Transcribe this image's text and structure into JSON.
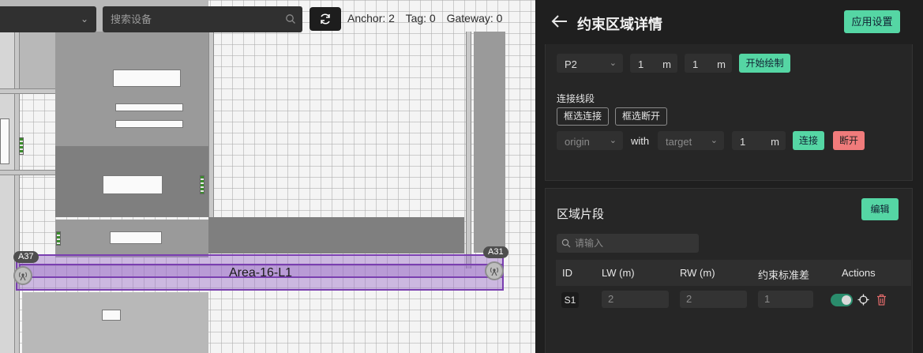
{
  "toolbar": {
    "search_placeholder": "搜索设备",
    "stats": {
      "anchor": "Anchor: 2",
      "tag": "Tag: 0",
      "gateway": "Gateway: 0"
    }
  },
  "map": {
    "area_label": "Area-16-L1",
    "anchors": [
      {
        "id": "A37"
      },
      {
        "id": "A31"
      }
    ]
  },
  "panel": {
    "title": "约束区域详情",
    "apply_label": "应用设置",
    "point_row": {
      "point": "P2",
      "value1": "1",
      "unit1": "m",
      "value2": "1",
      "unit2": "m",
      "start_draw_label": "开始绘制"
    },
    "connect": {
      "section_label": "连接线段",
      "box_connect_label": "框选连接",
      "box_disconnect_label": "框选断开",
      "origin_placeholder": "origin",
      "with_label": "with",
      "target_placeholder": "target",
      "distance_value": "1",
      "distance_unit": "m",
      "connect_label": "连接",
      "disconnect_label": "断开"
    },
    "segments": {
      "title": "区域片段",
      "edit_label": "编辑",
      "search_placeholder": "请输入",
      "columns": [
        "ID",
        "LW (m)",
        "RW (m)",
        "约束标准差",
        "Actions"
      ],
      "rows": [
        {
          "id": "S1",
          "lw": "2",
          "rw": "2",
          "std": "1",
          "enabled": true
        }
      ]
    }
  },
  "colors": {
    "accent": "#55d6a4",
    "danger": "#f07b7b",
    "area": "#7a3fb0",
    "panel_bg": "#1f1f1f"
  },
  "icons": [
    "chevron-down-icon",
    "search-icon",
    "refresh-icon",
    "back-arrow-icon",
    "anchor-icon",
    "locate-icon",
    "trash-icon"
  ]
}
